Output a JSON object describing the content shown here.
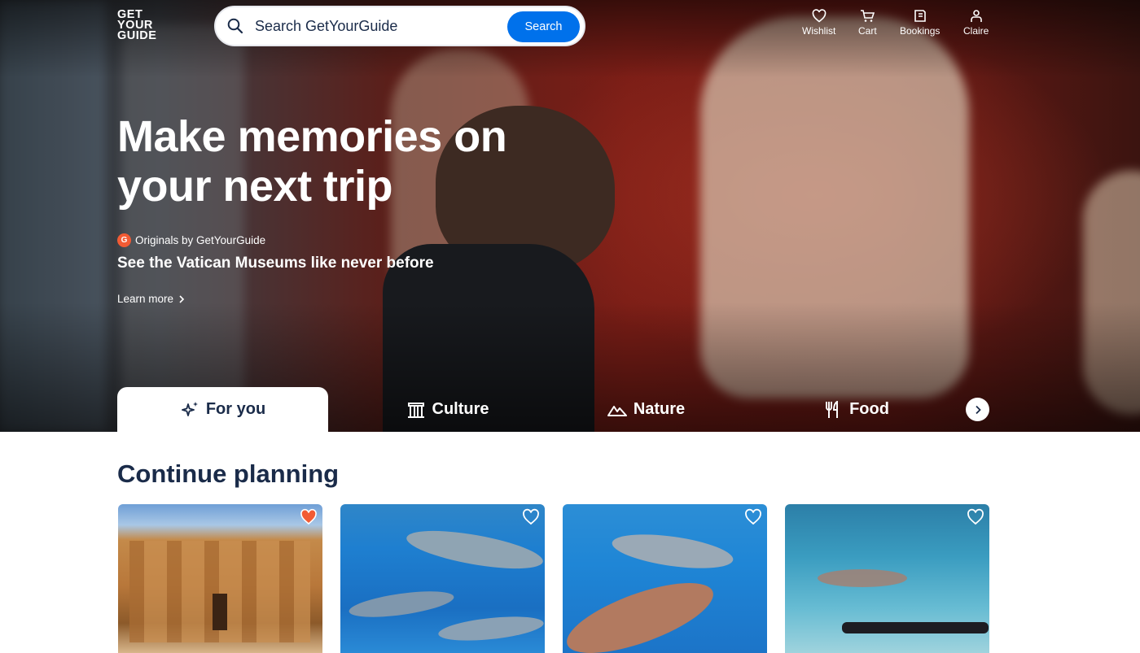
{
  "brand": {
    "logo_lines": [
      "GET",
      "YOUR",
      "GUIDE"
    ]
  },
  "search": {
    "placeholder": "Search GetYourGuide",
    "button": "Search"
  },
  "nav": [
    {
      "label": "Wishlist",
      "icon": "heart-icon"
    },
    {
      "label": "Cart",
      "icon": "cart-icon"
    },
    {
      "label": "Bookings",
      "icon": "ticket-icon"
    },
    {
      "label": "Claire",
      "icon": "user-icon"
    }
  ],
  "hero": {
    "title": "Make memories on your next trip",
    "originals_badge": "G",
    "originals": "Originals by GetYourGuide",
    "subtitle": "See the Vatican Museums like never before",
    "learn_more": "Learn more"
  },
  "tabs": [
    {
      "label": "For you",
      "icon": "sparkle-icon",
      "active": true
    },
    {
      "label": "Culture",
      "icon": "museum-icon",
      "active": false
    },
    {
      "label": "Nature",
      "icon": "mountain-icon",
      "active": false
    },
    {
      "label": "Food",
      "icon": "utensils-icon",
      "active": false
    }
  ],
  "section": {
    "title": "Continue planning"
  },
  "cards": [
    {
      "subject": "Abu Simbel temple",
      "wishlisted": true
    },
    {
      "subject": "Dolphins underwater",
      "wishlisted": false
    },
    {
      "subject": "Dolphins underwater",
      "wishlisted": false
    },
    {
      "subject": "Snorkeler with dolphins",
      "wishlisted": false
    }
  ],
  "colors": {
    "accent": "#0071eb",
    "navy": "#1a2b49",
    "heart_active": "#f25b34"
  }
}
